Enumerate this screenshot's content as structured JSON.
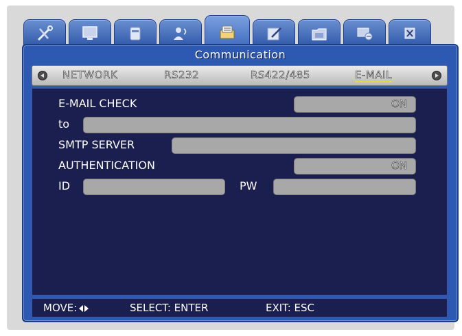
{
  "window": {
    "title": "Communication"
  },
  "menu_tabs": [
    {
      "icon": "tools-icon"
    },
    {
      "icon": "monitor-icon"
    },
    {
      "icon": "disk-icon"
    },
    {
      "icon": "camera-icon"
    },
    {
      "icon": "communication-icon",
      "active": true
    },
    {
      "icon": "edit-icon"
    },
    {
      "icon": "folder-icon"
    },
    {
      "icon": "network-icon"
    },
    {
      "icon": "close-icon"
    }
  ],
  "subtabs": [
    "NETWORK",
    "RS232",
    "RS422/485",
    "E-MAIL"
  ],
  "active_subtab": "E-MAIL",
  "form": {
    "email_check_label": "E-MAIL CHECK",
    "email_check_value": "ON",
    "to_label": "to",
    "to_value": "",
    "smtp_label": "SMTP SERVER",
    "smtp_value": "",
    "auth_label": "AUTHENTICATION",
    "auth_value": "ON",
    "id_label": "ID",
    "id_value": "",
    "pw_label": "PW",
    "pw_value": ""
  },
  "status": {
    "move": "MOVE:",
    "select": "SELECT: ENTER",
    "exit": "EXIT: ESC"
  },
  "colors": {
    "panel": "#2e59b2",
    "content_bg": "#1a1f4f",
    "field": "#a8a8a8",
    "active_underline": "#e8d640"
  }
}
